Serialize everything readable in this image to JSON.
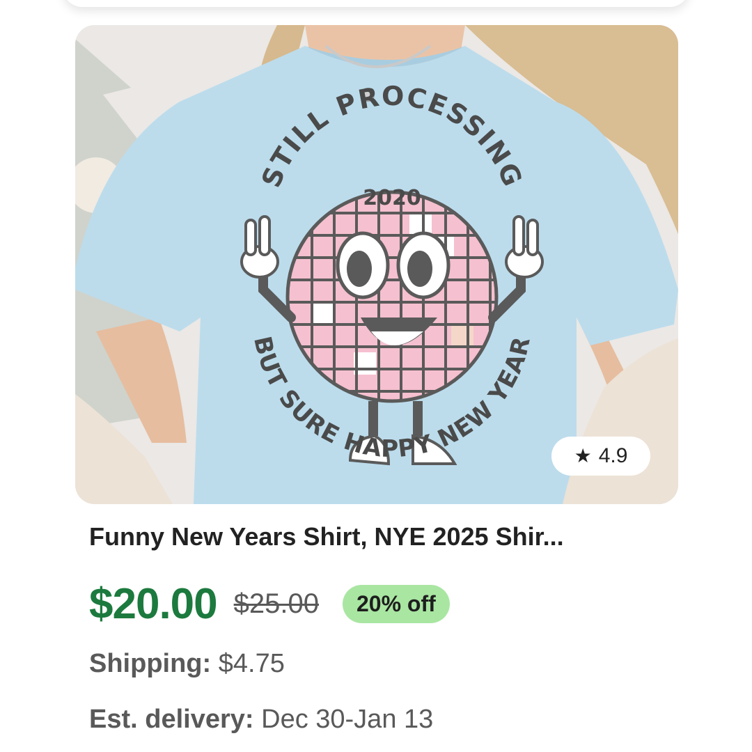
{
  "listing": {
    "image_alt": "Light blue t-shirt with disco ball graphic",
    "graphic_text": {
      "top": "STILL PROCESSING",
      "year": "2020",
      "bottom": "BUT SURE HAPPY NEW YEAR"
    },
    "rating": "4.9",
    "title": "Funny New Years Shirt, NYE 2025 Shir...",
    "price": "$20.00",
    "original_price": "$25.00",
    "discount_badge": "20% off",
    "shipping_label": "Shipping:",
    "shipping_value": "$4.75",
    "delivery_label": "Est. delivery:",
    "delivery_value": "Dec 30-Jan 13"
  },
  "colors": {
    "price_green": "#1c7a3e",
    "badge_green": "#a9e6a2",
    "shirt_blue": "#bcdcec",
    "disco_pink": "#f2b6c8"
  },
  "icons": {
    "rating": "star-icon"
  }
}
